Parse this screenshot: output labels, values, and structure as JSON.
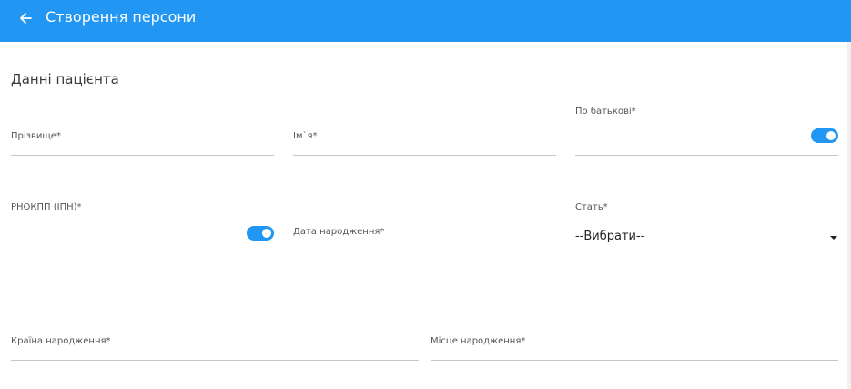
{
  "header": {
    "title": "Створення персони",
    "back_icon": "arrow-left-icon"
  },
  "form": {
    "section_title": "Данні пацієнта",
    "surname_label": "Прізвище*",
    "name_label": "Ім`я*",
    "patronymic_label": "По батькові*",
    "patronymic_toggle_on": true,
    "rnokpp_label": "РНОКПП (ІПН)*",
    "rnokpp_toggle_on": true,
    "birthdate_label": "Дата народження*",
    "gender_label": "Стать*",
    "gender_value": "--Вибрати--",
    "country_label": "Країна народження*",
    "birthplace_label": "Місце народження*"
  },
  "colors": {
    "primary": "#2196f3",
    "underline": "#c6c6c6"
  }
}
